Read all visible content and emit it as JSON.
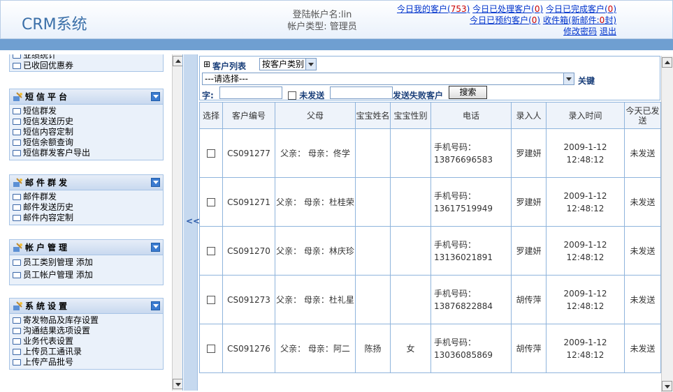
{
  "header": {
    "app_title": "CRM系统",
    "account_label": "登陆帐户名:lin",
    "account_type": "帐户类型: 管理员",
    "links": {
      "today_my_clients": "今日我的客户",
      "today_my_clients_count": "753",
      "today_processed": "今日已处理客户",
      "today_processed_count": "0",
      "today_completed": "今日已完成客户",
      "today_completed_count": "0",
      "today_booked": "今日已预约客户",
      "today_booked_count": "0",
      "inbox": "收件箱(新邮件:",
      "inbox_count": "0",
      "inbox_unit": "封)",
      "change_password": "修改密码",
      "logout": "退出"
    }
  },
  "sidebar": {
    "top_items": [
      "业绩统计",
      "已收回优惠券"
    ],
    "panels": [
      {
        "title": "短信平台",
        "items": [
          "短信群发",
          "短信发送历史",
          "短信内容定制",
          "短信余额查询",
          "短信群发客户导出"
        ]
      },
      {
        "title": "邮件群发",
        "items": [
          "邮件群发",
          "邮件发送历史",
          "邮件内容定制"
        ]
      },
      {
        "title": "帐户管理",
        "items": [
          "员工类别管理 添加",
          "员工帐户管理 添加"
        ]
      },
      {
        "title": "系统设置",
        "items": [
          "寄发物品及库存设置",
          "沟通结果选项设置",
          "业务代表设置",
          "上传员工通讯录",
          "上传产品批号"
        ]
      }
    ]
  },
  "splitter": {
    "label": "<<"
  },
  "filters": {
    "list_title": "客户列表",
    "type_select": "按客户类别",
    "please_select": "---请选择---",
    "keyword_label": "关键",
    "keyword_suffix": "字:",
    "unsent_label": "未发送",
    "failed_label": "发送失败客户",
    "search_button": "搜索"
  },
  "table": {
    "headers": [
      "选择",
      "客户编号",
      "父母",
      "宝宝姓名",
      "宝宝性别",
      "电话",
      "录入人",
      "录入时间",
      "今天已发送"
    ],
    "rows": [
      {
        "id": "CS091277",
        "parents": "父亲： 母亲：佟学",
        "baby_name": "",
        "baby_gender": "",
        "phone_label": "手机号码：",
        "phone": "13876696583",
        "entered_by": "罗建妍",
        "entered_at": "2009-1-12 12:48:12",
        "sent_today": "未发送"
      },
      {
        "id": "CS091271",
        "parents": "父亲： 母亲：杜桂荣",
        "baby_name": "",
        "baby_gender": "",
        "phone_label": "手机号码：",
        "phone": "13617519949",
        "entered_by": "罗建妍",
        "entered_at": "2009-1-12 12:48:12",
        "sent_today": "未发送"
      },
      {
        "id": "CS091270",
        "parents": "父亲： 母亲：林庆珍",
        "baby_name": "",
        "baby_gender": "",
        "phone_label": "手机号码：",
        "phone": "13136021891",
        "entered_by": "罗建妍",
        "entered_at": "2009-1-12 12:48:12",
        "sent_today": "未发送"
      },
      {
        "id": "CS091273",
        "parents": "父亲： 母亲：杜礼星",
        "baby_name": "",
        "baby_gender": "",
        "phone_label": "手机号码：",
        "phone": "13876822884",
        "entered_by": "胡传萍",
        "entered_at": "2009-1-12 12:48:12",
        "sent_today": "未发送"
      },
      {
        "id": "CS091276",
        "parents": "父亲： 母亲：阿二",
        "baby_name": "陈扬",
        "baby_gender": "女",
        "phone_label": "手机号码：",
        "phone": "13036085869",
        "entered_by": "胡传萍",
        "entered_at": "2009-1-12 12:48:12",
        "sent_today": "未发送"
      }
    ]
  }
}
